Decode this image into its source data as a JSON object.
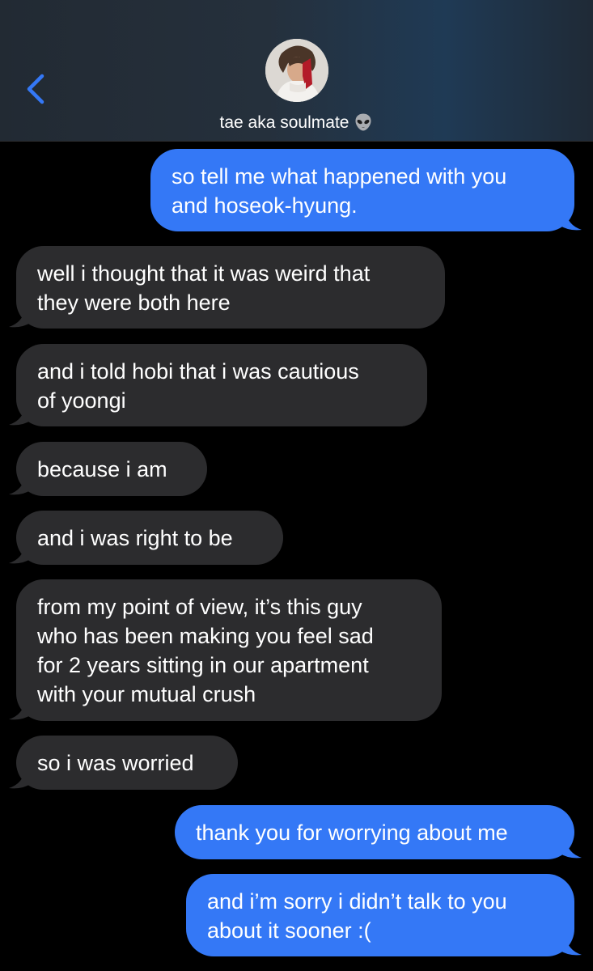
{
  "header": {
    "contact_name": "tae aka soulmate",
    "contact_emoji": "alien-emoji",
    "back_icon": "chevron-left-icon",
    "colors": {
      "accent": "#3478f6"
    }
  },
  "messages": [
    {
      "direction": "out",
      "text": "so tell me what happened with you\nand hoseok-hyung."
    },
    {
      "direction": "in",
      "text": "well i thought that it was weird that\nthey were both here"
    },
    {
      "direction": "in",
      "text": "and i told hobi that i was cautious\nof yoongi"
    },
    {
      "direction": "in",
      "text": "because i am"
    },
    {
      "direction": "in",
      "text": "and i was right to be"
    },
    {
      "direction": "in",
      "text": "from my point of view, it’s this guy\nwho has been making you feel sad\nfor 2 years sitting in our apartment\nwith your mutual crush"
    },
    {
      "direction": "in",
      "text": "so i was worried"
    },
    {
      "direction": "out",
      "text": "thank you for worrying about me"
    },
    {
      "direction": "out",
      "text": "and i’m sorry i didn’t talk to you\nabout it sooner :("
    }
  ],
  "colors": {
    "outgoing_bubble": "#3478f6",
    "incoming_bubble": "#2c2c2e",
    "background": "#000000"
  }
}
